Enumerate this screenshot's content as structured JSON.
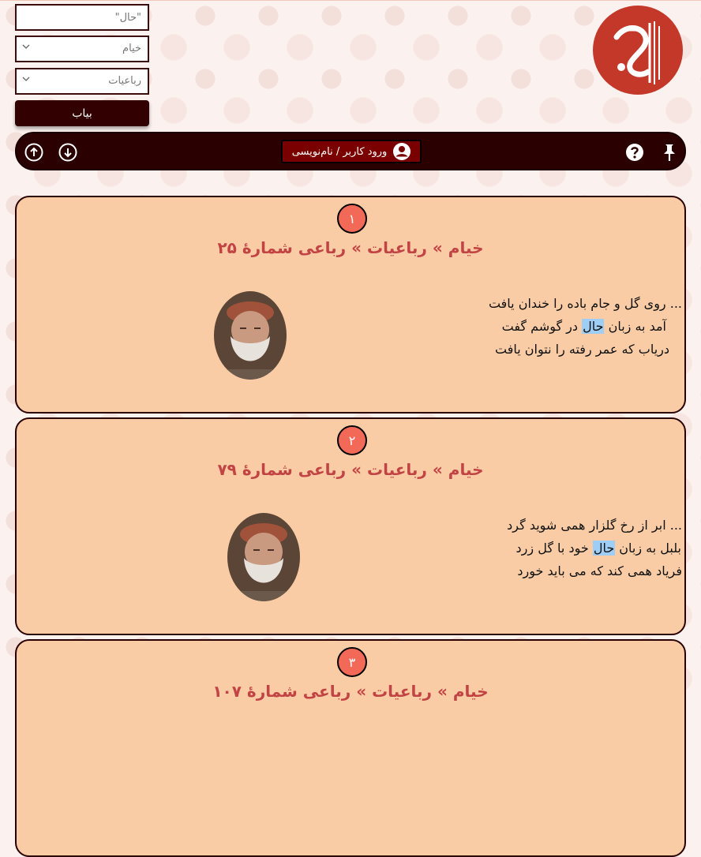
{
  "search": {
    "query_value": "\"حال\"",
    "poet_value": "خیام",
    "book_value": "رباعیات",
    "submit_label": "بیاب"
  },
  "nav": {
    "login_label": "ورود کاربر / نام‌نویسی"
  },
  "results": [
    {
      "number": "۱",
      "title": "خیام » رباعیات » رباعی شمارهٔ ۲۵",
      "lines": [
        {
          "pre": "... روی گل و جام باده را خندان یافت",
          "hl": "",
          "post": ""
        },
        {
          "pre": "آمد به زبان ",
          "hl": "حال",
          "post": " در گوشم گفت"
        },
        {
          "pre": "دریاب که عمر رفته را نتوان یافت",
          "hl": "",
          "post": ""
        }
      ]
    },
    {
      "number": "۲",
      "title": "خیام » رباعیات » رباعی شمارهٔ ۷۹",
      "lines": [
        {
          "pre": "... ابر از رخ گلزار همی شوید گرد",
          "hl": "",
          "post": ""
        },
        {
          "pre": "بلبل به زبان ",
          "hl": "حال",
          "post": " خود با گل زرد"
        },
        {
          "pre": "فریاد همی کند که می باید خورد",
          "hl": "",
          "post": ""
        }
      ]
    },
    {
      "number": "۳",
      "title": "خیام » رباعیات » رباعی شمارهٔ ۱۰۷",
      "lines": []
    }
  ],
  "colors": {
    "brand_dark": "#2a0000",
    "card_bg": "#f9cca5",
    "title_red": "#c24343",
    "number_badge": "#f26a57",
    "highlight": "#9ecdf6"
  },
  "icons": [
    "chevron-down-icon",
    "pin-icon",
    "help-icon",
    "user-icon",
    "arrow-down-circle-icon",
    "arrow-up-circle-icon",
    "logo"
  ]
}
